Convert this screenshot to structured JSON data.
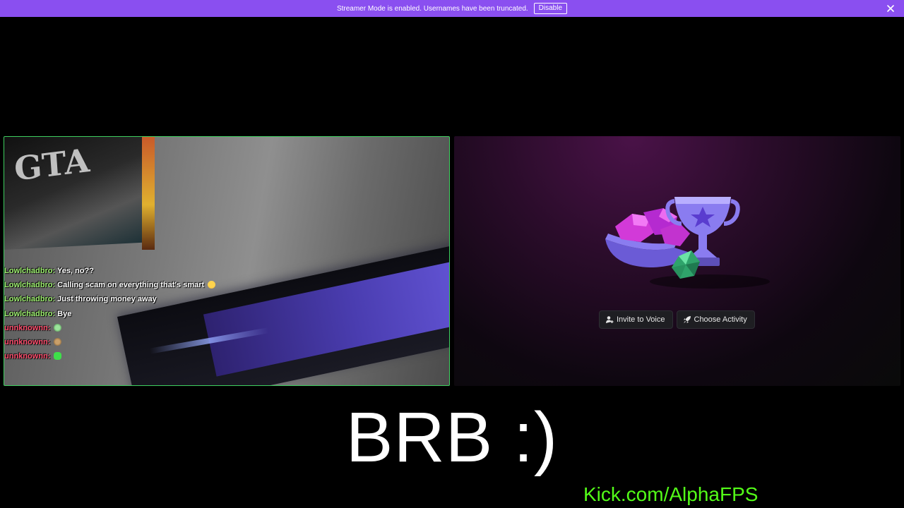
{
  "banner": {
    "text": "Streamer Mode is enabled. Usernames have been truncated.",
    "disable_label": "Disable",
    "color": "#8a4ff0"
  },
  "camera_tile": {
    "border_color": "#3ecf5f",
    "chat": [
      {
        "user": "Lowlchadbro:",
        "message": "Yes, no??",
        "emote": null
      },
      {
        "user": "Lowlchadbro:",
        "message": "Calling scam on everything that's smart",
        "emote": "laughing-emoji"
      },
      {
        "user": "Lowlchadbro:",
        "message": "Just throwing money away",
        "emote": null
      },
      {
        "user": "Lowlchadbro:",
        "message": "Bye",
        "emote": null
      },
      {
        "user": "unnknownn:",
        "message": "",
        "emote": "emote-1"
      },
      {
        "user": "unnknownn:",
        "message": "",
        "emote": "emote-2"
      },
      {
        "user": "unnknownn:",
        "message": "",
        "emote": "green-emote"
      }
    ]
  },
  "activity_tile": {
    "invite_label": "Invite to Voice",
    "invite_icon": "add-person-icon",
    "activity_label": "Choose Activity",
    "activity_icon": "rocket-icon"
  },
  "overlay": {
    "brb_text": "BRB :)",
    "kick_link": "Kick.com/AlphaFPS",
    "kick_color": "#53fc18"
  }
}
